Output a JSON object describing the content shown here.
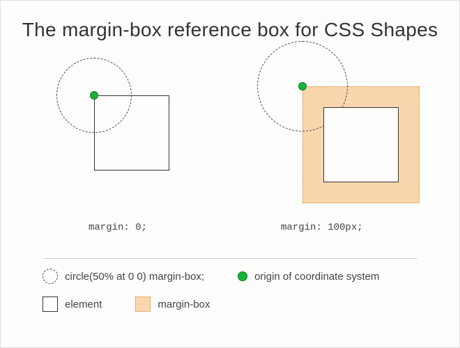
{
  "title": "The margin-box reference box for CSS Shapes",
  "captions": {
    "left": "margin: 0;",
    "right": "margin: 100px;"
  },
  "legend": {
    "circle": "circle(50% at 0 0) margin-box;",
    "dot": "origin of coordinate system",
    "square": "element",
    "marginbox": "margin-box"
  },
  "colors": {
    "marginbox_fill": "#f9d6ae",
    "marginbox_border": "#d88a3a",
    "origin_dot": "#18b33a"
  }
}
